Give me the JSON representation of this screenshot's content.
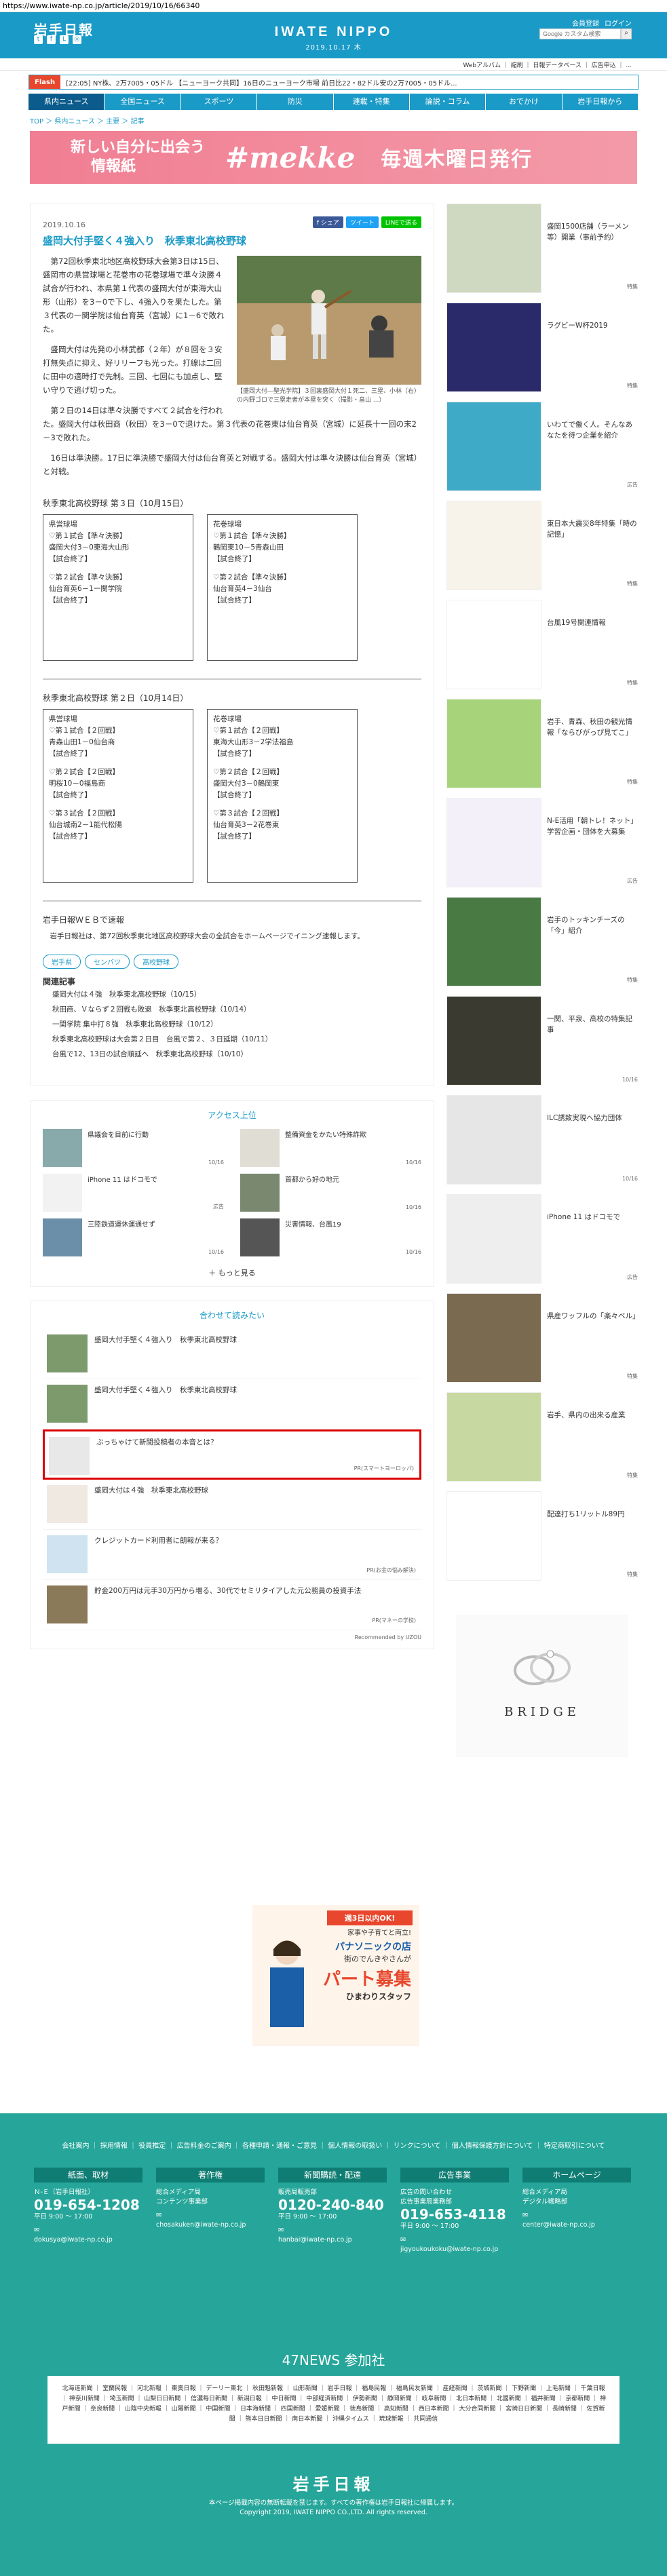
{
  "url": "https://www.iwate-np.co.jp/article/2019/10/16/66340",
  "header": {
    "logo": "岩手日報",
    "brand": "IWATE NIPPO",
    "date": "2019.10.17 木",
    "links": [
      "会員登録",
      "ログイン"
    ],
    "search_placeholder": "Google カスタム検索",
    "util": "Webアルバム ｜ 縮刷 ｜ 日報データベース ｜ 広告申込 ｜ ..."
  },
  "ticker": {
    "label": "Flash",
    "text": "[22:05] NY株、2万7005・05ドル  【ニューヨーク共同】16日のニューヨーク市場 前日比22・82ドル安の2万7005・05ドル..."
  },
  "nav": [
    "県内ニュース",
    "全国ニュース",
    "スポーツ",
    "防災",
    "連載・特集",
    "論説・コラム",
    "おでかけ",
    "岩手日報から"
  ],
  "breadcrumb": "TOP ＞ 県内ニュース ＞ 主要 ＞ 記事",
  "banner": {
    "line1": "新しい自分に出会う",
    "line2": "情報紙",
    "brand": "#mekke",
    "tagline": "毎週木曜日発行"
  },
  "article": {
    "date": "2019.10.16",
    "share": [
      "f シェア",
      "ツイート",
      "LINEで送る"
    ],
    "title": "盛岡大付手堅く４強入り　秋季東北高校野球",
    "caption": "【盛岡大付―聖光学院】３回裏盛岡大付１死二、三塁、小林（右）の内野ゴロで三塁走者が本塁を突く（撮影・畠山 ...）",
    "paragraphs": [
      "第72回秋季東北地区高校野球大会第3日は15日、盛岡市の県営球場と花巻市の花巻球場で準々決勝４試合が行われ、本県第１代表の盛岡大付が東海大山形（山形）を3－0で下し、4強入りを果たした。第３代表の一関学院は仙台育英（宮城）に1－6で敗れた。",
      "盛岡大付は先発の小林武都（２年）が８回を３安打無失点に抑え、好リリーフも光った。打線は二回に田中の適時打で先制。三回、七回にも加点し、堅い守りで逃げ切った。",
      "第２日の14日は準々決勝ですべて２試合を行われた。盛岡大付は秋田商（秋田）を3－0で退けた。第３代表の花巻東は仙台育英（宮城）に延長十一回の末2－3で敗れた。",
      "16日は準決勝。17日に準決勝で盛岡大付は仙台育英と対戦する。盛岡大付は準々決勝は仙台育英（宮城）と対戦。"
    ],
    "sched3_title": "秋季東北高校野球 第３日（10月15日）",
    "sched3": [
      [
        "県営球場",
        "♡第１試合【準々決勝】",
        "盛岡大付3－0東海大山形",
        "【試合終了】",
        "",
        "♡第２試合【準々決勝】",
        "仙台育英6－1一関学院",
        "【試合終了】"
      ],
      [
        "花巻球場",
        "♡第１試合【準々決勝】",
        "鶴岡東10－5青森山田",
        "【試合終了】",
        "",
        "♡第２試合【準々決勝】",
        "仙台育英4－3仙台",
        "【試合終了】"
      ]
    ],
    "sched2_title": "秋季東北高校野球 第２日（10月14日）",
    "sched2": [
      [
        "県営球場",
        "♡第１試合【２回戦】",
        "青森山田1－0仙台商",
        "【試合終了】",
        "",
        "♡第２試合【２回戦】",
        "明桜10－0福島商",
        "【試合終了】",
        "",
        "♡第３試合【２回戦】",
        "仙台城南2－1能代松陽",
        "【試合終了】"
      ],
      [
        "花巻球場",
        "♡第１試合【２回戦】",
        "東海大山形3－2学法福島",
        "【試合終了】",
        "",
        "♡第２試合【２回戦】",
        "盛岡大付3－0鶴岡東",
        "【試合終了】",
        "",
        "♡第３試合【２回戦】",
        "仙台育英3－2花巻東",
        "【試合終了】"
      ]
    ],
    "web_title": "岩手日報ＷＥＢで速報",
    "web_text": "岩手日報社は、第72回秋季東北地区高校野球大会の全試合をホームページでイニング速報します。",
    "tags": [
      "岩手県",
      "センバツ",
      "高校野球"
    ],
    "related_title": "関連記事",
    "related": [
      "盛岡大付は４強　秋季東北高校野球（10/15）",
      "秋田商、Ｖならず２回戦も敗退　秋季東北高校野球（10/14）",
      "一関学院 集中打８強　秋季東北高校野球（10/12）",
      "秋季東北高校野球は大会第２日目　台風で第２、３日延期（10/11）",
      "台風で12、13日の試合順延へ　秋季東北高校野球（10/10）"
    ]
  },
  "access": {
    "title": "アクセス上位",
    "items": [
      {
        "t": "県議会を目前に行動",
        "d": "10/16"
      },
      {
        "t": "整備資金をかたい特殊詐欺",
        "d": "10/16"
      },
      {
        "t": "iPhone 11 はドコモで",
        "d": "広告"
      },
      {
        "t": "首都から好の地元",
        "d": "10/16"
      },
      {
        "t": "三陸鉄道運休運通せず",
        "d": "10/16"
      },
      {
        "t": "災害情報、台風19",
        "d": "10/16"
      }
    ],
    "more": "＋ もっと見る"
  },
  "recommend": {
    "title": "合わせて読みたい",
    "items": [
      {
        "t": "盛岡大付手堅く４強入り　秋季東北高校野球",
        "pr": ""
      },
      {
        "t": "盛岡大付手堅く４強入り　秋季東北高校野球",
        "pr": ""
      },
      {
        "t": "ぶっちゃけて新聞投稿者の本音とは？",
        "pr": "PR(スマートヨーロッパ)"
      },
      {
        "t": "盛岡大付は４強　秋季東北高校野球",
        "pr": ""
      },
      {
        "t": "クレジットカード利用者に朗報が来る？",
        "pr": "PR(お金の悩み解決)"
      },
      {
        "t": "貯金200万円は元手30万円から増る、30代でセミリタイアした元公務員の投資手法",
        "pr": "PR(マネーの学校)"
      }
    ],
    "powered": "Recommended by UZOU"
  },
  "sidebar": [
    {
      "t": "盛岡1500店舗（ラーメン等）開業（事前予約）",
      "d": "特集"
    },
    {
      "t": "ラグビーW杯2019",
      "d": "特集"
    },
    {
      "t": "いわてで働く人。そんなあなたを待つ企業を紹介",
      "d": "広告"
    },
    {
      "t": "東日本大震災8年特集「時の記憶」",
      "d": "特集"
    },
    {
      "t": "台風19号関連情報",
      "d": "特集"
    },
    {
      "t": "岩手、青森、秋田の観光情報「ならびがっぴ見てこ」",
      "d": "特集"
    },
    {
      "t": "N-E活用「朝トレ！ネット」学習企画・団体を大募集",
      "d": "広告"
    },
    {
      "t": "岩手のトッキンチーズの「今」紹介",
      "d": "特集"
    },
    {
      "t": "一関、平泉、高校の特集記事",
      "d": "10/16"
    },
    {
      "t": "ILC誘致実現へ協力団体",
      "d": "10/16"
    },
    {
      "t": "iPhone 11 はドコモで",
      "d": "広告"
    },
    {
      "t": "県産ワッフルの「楽々ベル」",
      "d": "特集"
    },
    {
      "t": "岩手、県内の出来る産業",
      "d": "特集"
    },
    {
      "t": "配達打ち1リットル89円",
      "d": "特集"
    }
  ],
  "side_ad_text": "BRIDGE",
  "mid_ad": {
    "line1": "週3日以内OK!",
    "line2": "家事や子育てと両立!",
    "line3": "パナソニックの店",
    "line4": "街のでんきやさんが",
    "line5": "パート募集",
    "line6": "ひまわりスタッフ"
  },
  "footer": {
    "links": "会社案内 ｜ 採用情報 ｜ 役員推定 ｜ 広告料金のご案内 ｜ 各種申請・通報・ご意見 ｜ 個人情報の取扱い ｜ リンクについて ｜ 個人情報保護方針について ｜ 特定商取引について",
    "contacts": [
      {
        "hd": "紙面、取材",
        "sub": "Ｎ-Ｅ（岩手日報社）",
        "tel": "019-654-1208",
        "hours": "平日 9:00 ～ 17:00",
        "mail": "dokusya@iwate-np.co.jp"
      },
      {
        "hd": "著作権",
        "sub": "総合メディア局\nコンテンツ事業部",
        "tel": "",
        "hours": "",
        "mail": "chosakuken@iwate-np.co.jp"
      },
      {
        "hd": "新聞購読・配達",
        "sub": "販売局販売部",
        "tel": "0120-240-840",
        "hours": "平日 9:00 ～ 17:00",
        "mail": "hanbai@iwate-np.co.jp"
      },
      {
        "hd": "広告事業",
        "sub": "広告の問い合わせ\n広告事業局業務部",
        "tel": "019-653-4118",
        "hours": "平日 9:00 ～ 17:00",
        "mail": "jigyoukoukoku@iwate-np.co.jp"
      },
      {
        "hd": "ホームページ",
        "sub": "総合メディア局\nデジタル戦略部",
        "tel": "",
        "hours": "",
        "mail": "center@iwate-np.co.jp"
      }
    ],
    "news47": "47NEWS 参加社",
    "news_list": "北海道新聞 ｜ 室蘭民報 ｜ 河北新報 ｜ 東奥日報 ｜ デーリー東北 ｜ 秋田魁新報 ｜ 山形新聞 ｜ 岩手日報 ｜ 福島民報 ｜ 福島民友新聞 ｜ 産経新聞 ｜ 茨城新聞 ｜ 下野新聞 ｜ 上毛新聞 ｜ 千葉日報 ｜ 神奈川新聞 ｜ 埼玉新聞 ｜ 山梨日日新聞 ｜ 信濃毎日新聞 ｜ 新潟日報 ｜ 中日新聞 ｜ 中部経済新聞 ｜ 伊勢新聞 ｜ 静岡新聞 ｜ 岐阜新聞 ｜ 北日本新聞 ｜ 北國新聞 ｜ 福井新聞 ｜ 京都新聞 ｜ 神戸新聞 ｜ 奈良新聞 ｜ 山陰中央新報 ｜ 山陽新聞 ｜ 中国新聞 ｜ 日本海新聞 ｜ 四国新聞 ｜ 愛媛新聞 ｜ 徳島新聞 ｜ 高知新聞 ｜ 西日本新聞 ｜ 大分合同新聞 ｜ 宮崎日日新聞 ｜ 長崎新聞 ｜ 佐賀新聞 ｜ 熊本日日新聞 ｜ 南日本新聞 ｜ 沖縄タイムス ｜ 琉球新報 ｜ 共同通信",
    "logo": "岩手日報",
    "note1": "本ページ掲載内容の無断転載を禁じます。すべての著作権は岩手日報社に帰属します。",
    "note2": "Copyright 2019, IWATE NIPPO CO.,LTD. All rights reserved."
  }
}
